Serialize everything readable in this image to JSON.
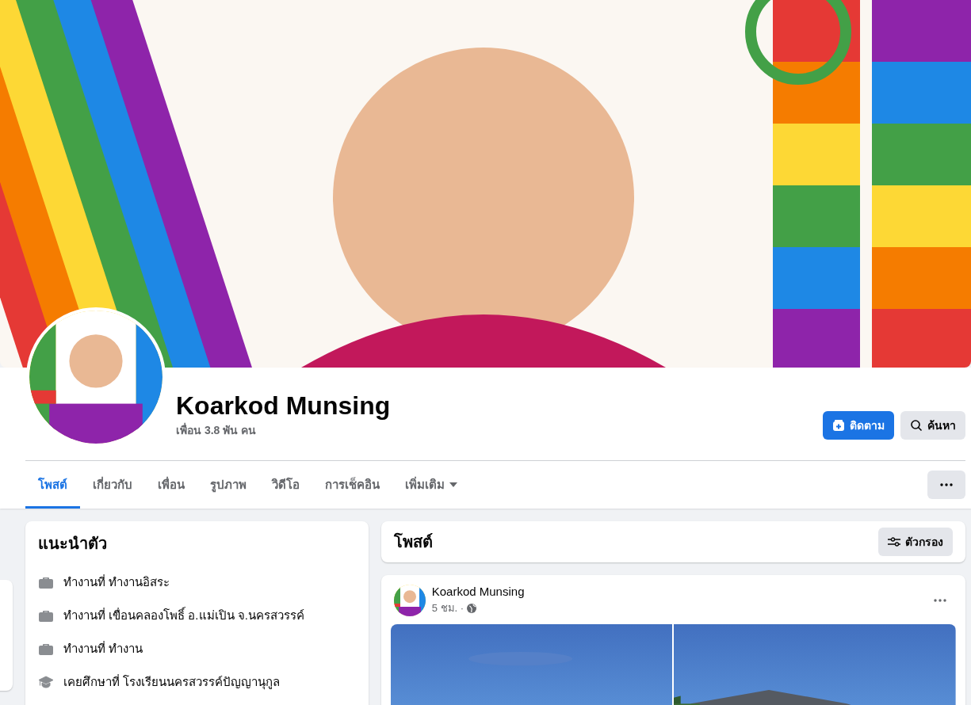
{
  "profile": {
    "name": "Koarkod Munsing",
    "friends": "เพื่อน 3.8 พัน คน"
  },
  "actions": [
    {
      "kind": "follow",
      "label": "ติดตาม"
    },
    {
      "kind": "search",
      "label": "ค้นหา"
    }
  ],
  "tabs": [
    {
      "label": "โพสต์",
      "selected": true,
      "kind": "plain"
    },
    {
      "label": "เกี่ยวกับ",
      "selected": false,
      "kind": "plain"
    },
    {
      "label": "เพื่อน",
      "selected": false,
      "kind": "plain"
    },
    {
      "label": "รูปภาพ",
      "selected": false,
      "kind": "plain"
    },
    {
      "label": "วิดีโอ",
      "selected": false,
      "kind": "plain"
    },
    {
      "label": "การเช็คอิน",
      "selected": false,
      "kind": "plain"
    },
    {
      "label": "เพิ่มเติม",
      "selected": false,
      "kind": "dropdown"
    }
  ],
  "intro": {
    "title": "แนะนำตัว",
    "items": [
      {
        "kind": "work",
        "text": "ทำงานที่ ทำงานอิสระ"
      },
      {
        "kind": "work",
        "text": "ทำงานที่ เขื่อนคลองโพธิ์ อ.แม่เปิน จ.นครสวรรค์"
      },
      {
        "kind": "work",
        "text": "ทำงานที่ ทำงาน"
      },
      {
        "kind": "study",
        "text": "เคยศึกษาที่ โรงเรียนนครสวรรค์ปัญญานุกูล"
      }
    ]
  },
  "posts_header": {
    "title": "โพสต์",
    "filter": "ตัวกรอง"
  },
  "post": {
    "author": "Koarkod Munsing",
    "time": "5 ชม. ·"
  }
}
